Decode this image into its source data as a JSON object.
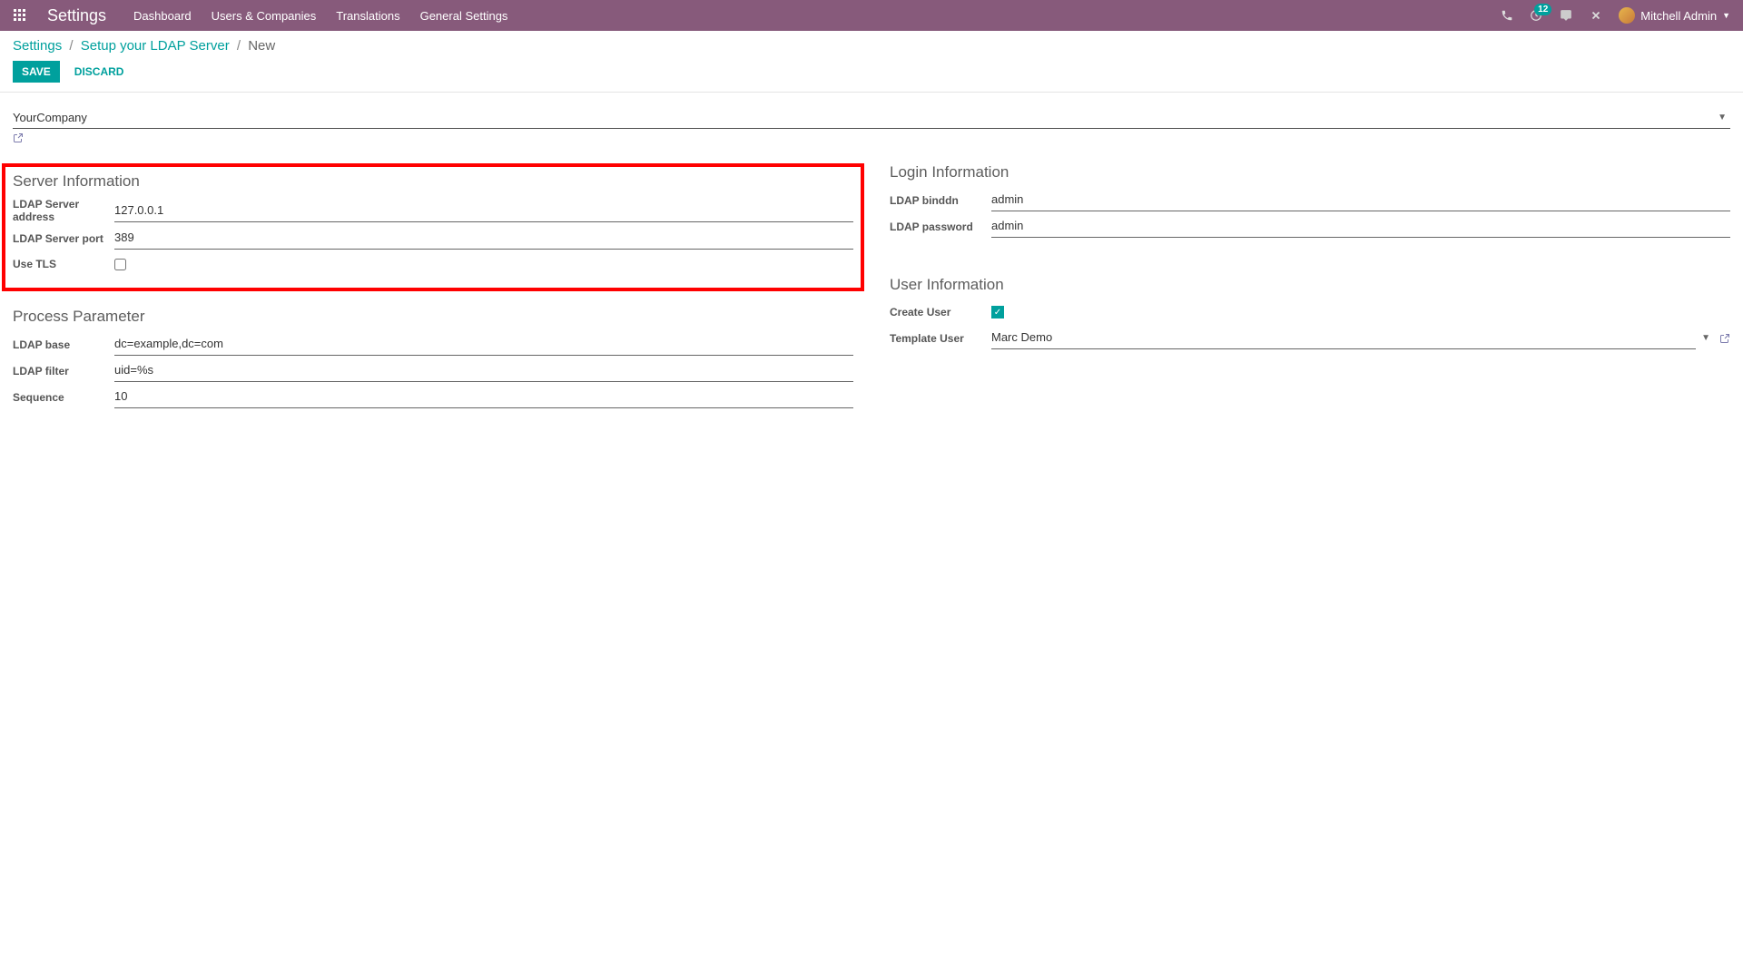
{
  "navbar": {
    "brand": "Settings",
    "menu": {
      "dashboard": "Dashboard",
      "users": "Users & Companies",
      "translations": "Translations",
      "general": "General Settings"
    },
    "badge_count": "12",
    "user_name": "Mitchell Admin"
  },
  "breadcrumb": {
    "settings": "Settings",
    "ldap_list": "Setup your LDAP Server",
    "current": "New"
  },
  "buttons": {
    "save": "SAVE",
    "discard": "DISCARD"
  },
  "company": {
    "value": "YourCompany"
  },
  "server_info": {
    "title": "Server Information",
    "address_label": "LDAP Server address",
    "address_value": "127.0.0.1",
    "port_label": "LDAP Server port",
    "port_value": "389",
    "tls_label": "Use TLS"
  },
  "login_info": {
    "title": "Login Information",
    "binddn_label": "LDAP binddn",
    "binddn_value": "admin",
    "password_label": "LDAP password",
    "password_value": "admin"
  },
  "process_param": {
    "title": "Process Parameter",
    "base_label": "LDAP base",
    "base_value": "dc=example,dc=com",
    "filter_label": "LDAP filter",
    "filter_value": "uid=%s",
    "sequence_label": "Sequence",
    "sequence_value": "10"
  },
  "user_info": {
    "title": "User Information",
    "create_user_label": "Create User",
    "template_user_label": "Template User",
    "template_user_value": "Marc Demo"
  }
}
